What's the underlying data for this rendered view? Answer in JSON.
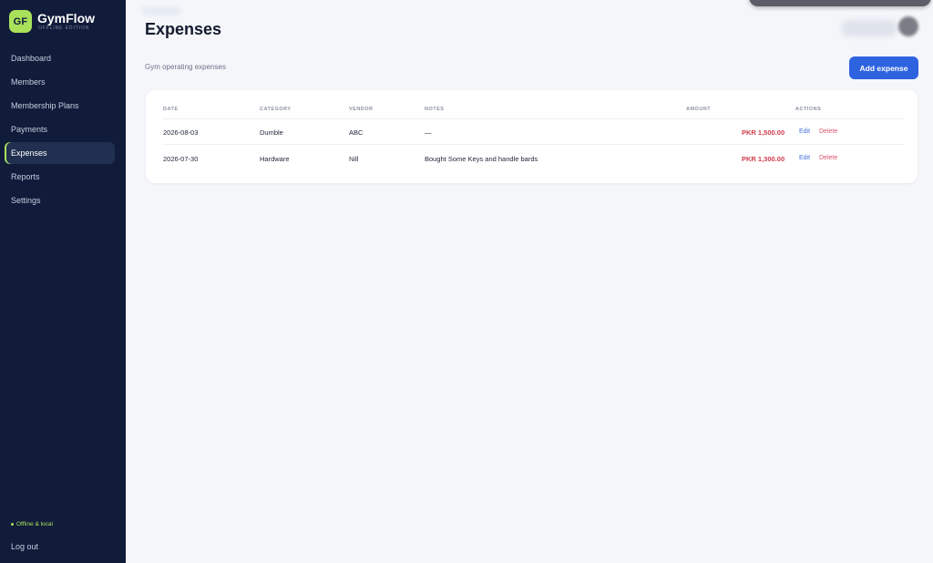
{
  "brand": {
    "logo": "GF",
    "name": "GymFlow",
    "edition": "OFFLINE EDITION"
  },
  "nav": {
    "items": [
      {
        "label": "Dashboard"
      },
      {
        "label": "Members"
      },
      {
        "label": "Membership Plans"
      },
      {
        "label": "Payments"
      },
      {
        "label": "Expenses",
        "active": true
      },
      {
        "label": "Reports"
      },
      {
        "label": "Settings"
      }
    ]
  },
  "footer": {
    "status": "Offline & local",
    "logout": "Log out"
  },
  "header": {
    "title": "Expenses",
    "subtitle": "Gym operating expenses",
    "add_button": "Add expense"
  },
  "table": {
    "columns": {
      "date": "DATE",
      "category": "CATEGORY",
      "vendor": "VENDOR",
      "notes": "NOTES",
      "amount": "AMOUNT",
      "actions": "ACTIONS"
    },
    "rows": [
      {
        "date": "2026-08-03",
        "category": "Dumble",
        "vendor": "ABC",
        "notes": "—",
        "amount": "PKR 1,500.00",
        "edit": "Edit",
        "delete": "Delete"
      },
      {
        "date": "2026-07-30",
        "category": "Hardware",
        "vendor": "Nill",
        "notes": "Bought Some Keys and handle bards",
        "amount": "PKR 1,300.00",
        "edit": "Edit",
        "delete": "Delete"
      }
    ]
  },
  "colors": {
    "sidebar": "#111c3a",
    "accent": "#a9e25a",
    "primary_button": "#2e63e0",
    "amount": "#d23c4c"
  }
}
